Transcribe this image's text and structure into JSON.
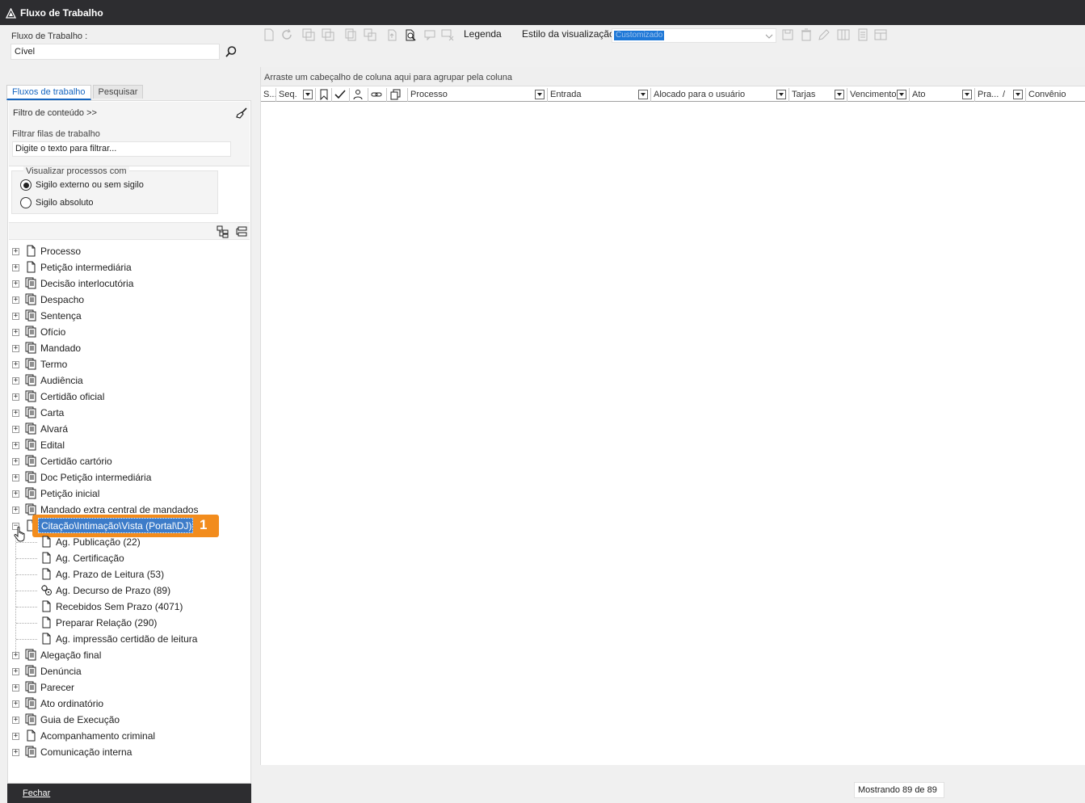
{
  "window": {
    "title": "Fluxo de Trabalho"
  },
  "left": {
    "fluxo_label": "Fluxo de Trabalho :",
    "fluxo_value": "Cível",
    "tabs": [
      {
        "label": "Fluxos de trabalho",
        "active": true
      },
      {
        "label": "Pesquisar",
        "active": false
      }
    ],
    "filtro_title": "Filtro de conteúdo >>",
    "filtrar_label": "Filtrar filas de trabalho",
    "filtrar_placeholder": "Digite o texto para filtrar...",
    "visualizar_title": "Visualizar processos com",
    "radios": [
      {
        "label": "Sigilo externo ou sem sigilo",
        "checked": true
      },
      {
        "label": "Sigilo absoluto",
        "checked": false
      }
    ],
    "tree": {
      "top_items": [
        {
          "label": "Processo",
          "icon": "page-icon"
        },
        {
          "label": "Petição intermediária",
          "icon": "page-icon"
        },
        {
          "label": "Decisão interlocutória",
          "icon": "docs-icon"
        },
        {
          "label": "Despacho",
          "icon": "docs-icon"
        },
        {
          "label": "Sentença",
          "icon": "docs-icon"
        },
        {
          "label": "Ofício",
          "icon": "docs-icon"
        },
        {
          "label": "Mandado",
          "icon": "docs-icon"
        },
        {
          "label": "Termo",
          "icon": "docs-icon"
        },
        {
          "label": "Audiência",
          "icon": "docs-icon"
        },
        {
          "label": "Certidão oficial",
          "icon": "docs-icon"
        },
        {
          "label": "Carta",
          "icon": "docs-icon"
        },
        {
          "label": "Alvará",
          "icon": "docs-icon"
        },
        {
          "label": "Edital",
          "icon": "docs-icon"
        },
        {
          "label": "Certidão cartório",
          "icon": "docs-icon"
        },
        {
          "label": "Doc Petição intermediária",
          "icon": "docs-icon"
        },
        {
          "label": "Petição inicial",
          "icon": "docs-icon"
        },
        {
          "label": "Mandado extra central de mandados",
          "icon": "docs-icon"
        }
      ],
      "selected": {
        "label": "Citação\\Intimação\\Vista (Portal\\DJ)",
        "marker": "1"
      },
      "children": [
        {
          "label": "Ag. Publicação (22)",
          "icon": "page-icon"
        },
        {
          "label": "Ag. Certificação",
          "icon": "page-icon"
        },
        {
          "label": "Ag. Prazo de Leitura (53)",
          "icon": "page-icon"
        },
        {
          "label": "Ag. Decurso de Prazo (89)",
          "icon": "gears-icon"
        },
        {
          "label": "Recebidos Sem Prazo (4071)",
          "icon": "page-icon"
        },
        {
          "label": "Preparar Relação (290)",
          "icon": "page-icon"
        },
        {
          "label": "Ag. impressão certidão de leitura",
          "icon": "page-icon"
        }
      ],
      "bottom_items": [
        {
          "label": "Alegação final",
          "icon": "docs-icon"
        },
        {
          "label": "Denúncia",
          "icon": "docs-icon"
        },
        {
          "label": "Parecer",
          "icon": "docs-icon"
        },
        {
          "label": "Ato ordinatório",
          "icon": "docs-icon"
        },
        {
          "label": "Guia de Execução",
          "icon": "docs-icon"
        },
        {
          "label": "Acompanhamento criminal",
          "icon": "page-icon"
        },
        {
          "label": "Comunicação interna",
          "icon": "docs-icon"
        }
      ]
    },
    "fechar_label": "Fechar"
  },
  "toolbar": {
    "legenda_label": "Legenda",
    "estilo_label": "Estilo da visualização",
    "estilo_value": "Customizado"
  },
  "grid": {
    "group_hint": "Arraste um cabeçalho de coluna aqui para agrupar pela coluna",
    "columns": {
      "s": "S...",
      "seq": "Seq.",
      "processo": "Processo",
      "entrada": "Entrada",
      "alocado": "Alocado para o usuário",
      "tarjas": "Tarjas",
      "vencimento": "Vencimento",
      "ato": "Ato",
      "prazo": "Pra...",
      "prazo_sort": "/",
      "convenio": "Convênio"
    }
  },
  "status": {
    "text": "Mostrando 89 de 89"
  },
  "colors": {
    "titlebar": "#2d2d30",
    "selection": "#3d7cc9",
    "marker": "#f28c1d",
    "tab_active": "#1565c0"
  }
}
